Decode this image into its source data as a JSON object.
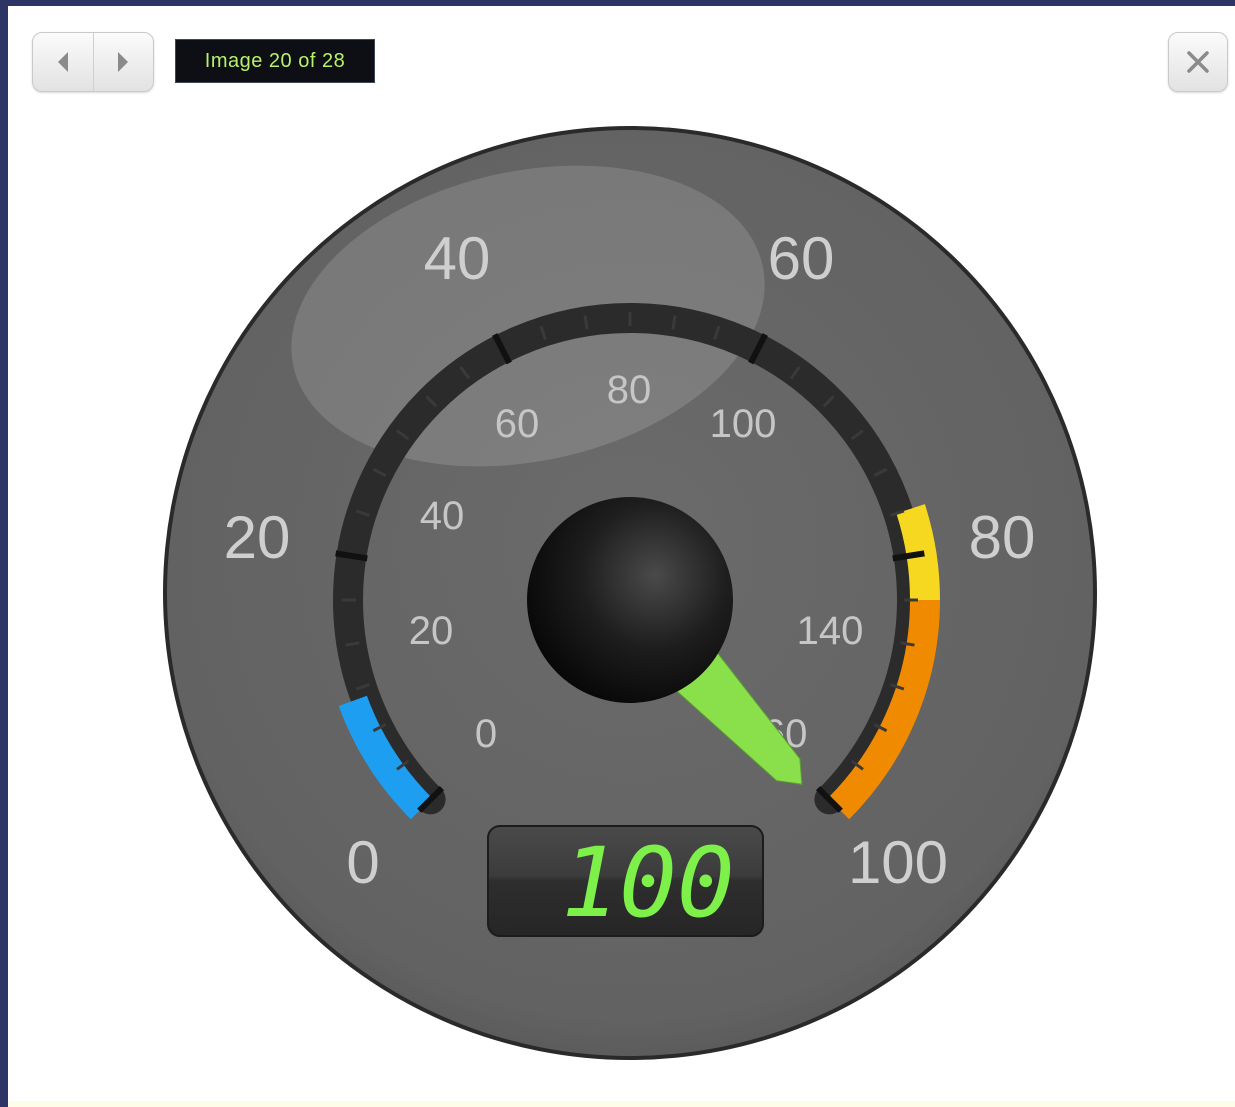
{
  "viewer": {
    "counter_text": "Image 20 of 28",
    "prev_icon": "chevron-left-icon",
    "next_icon": "chevron-right-icon",
    "close_icon": "close-icon"
  },
  "gauge": {
    "outer_ticks": [
      "0",
      "20",
      "40",
      "60",
      "80",
      "100"
    ],
    "inner_ticks": [
      "0",
      "20",
      "40",
      "60",
      "80",
      "100",
      "140",
      "160"
    ],
    "digital_readout": "100",
    "needle_value": 100,
    "outer_scale": {
      "min": 0,
      "max": 100
    },
    "bands": [
      {
        "name": "low",
        "color": "#1e9ef0"
      },
      {
        "name": "warning",
        "color": "#f7d820"
      },
      {
        "name": "high",
        "color": "#f08a00"
      }
    ],
    "needle_color": "#8ae04a",
    "readout_color": "#7ef04a"
  }
}
